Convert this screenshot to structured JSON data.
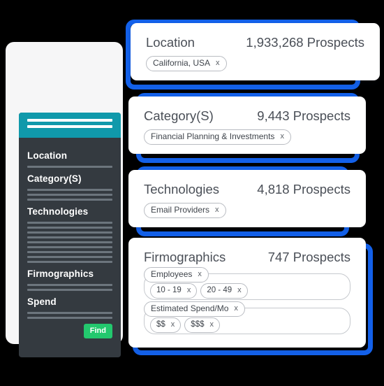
{
  "sidebar": {
    "header_bars": 2,
    "accent_color": "#1099ab",
    "panel_color": "#343a40",
    "groups": [
      {
        "title": "Location",
        "lines": 1
      },
      {
        "title": "Category(S)",
        "lines": 3
      },
      {
        "title": "Technologies",
        "lines": 9
      },
      {
        "title": "Firmographics",
        "lines": 2
      },
      {
        "title": "Spend",
        "lines": 2
      }
    ],
    "find_label": "Find",
    "find_color": "#23c86e"
  },
  "accent_frame_color": "#1462ec",
  "cards": [
    {
      "title": "Location",
      "count": "1,933,268 Prospects",
      "chips": [
        {
          "label": "California, USA",
          "remove": "x"
        }
      ]
    },
    {
      "title": "Category(S)",
      "count": "9,443 Prospects",
      "chips": [
        {
          "label": "Financial Planning & Investments",
          "remove": "x"
        }
      ]
    },
    {
      "title": "Technologies",
      "count": "4,818 Prospects",
      "chips": [
        {
          "label": "Email Providers",
          "remove": "x"
        }
      ]
    },
    {
      "title": "Firmographics",
      "count": "747  Prospects",
      "groups": [
        {
          "label": "Employees",
          "remove": "x",
          "items": [
            {
              "label": "10 - 19",
              "remove": "x"
            },
            {
              "label": "20 - 49",
              "remove": "x"
            }
          ]
        },
        {
          "label": "Estimated Spend/Mo",
          "remove": "x",
          "items": [
            {
              "label": "$$",
              "remove": "x"
            },
            {
              "label": "$$$",
              "remove": "x"
            }
          ]
        }
      ]
    }
  ]
}
